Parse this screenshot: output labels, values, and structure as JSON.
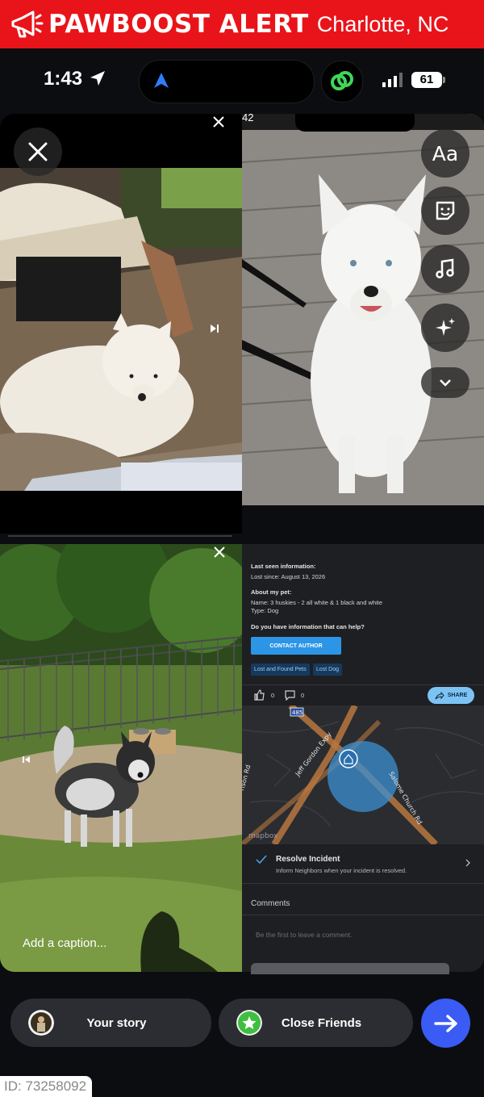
{
  "banner": {
    "brand": "PAWBOOST ALERT",
    "location": "Charlotte, NC",
    "icon": "megaphone-icon",
    "bg_color": "#e8141a"
  },
  "status_bar": {
    "time": "1:43",
    "battery": "61",
    "icons": [
      "location-arrow-icon",
      "signal-icon",
      "battery-icon"
    ]
  },
  "left_top_panel": {
    "close_icon": "close-icon",
    "secondary_close_icon": "close-icon",
    "play_icon": "skip-icon"
  },
  "right_top_panel": {
    "peek_time": "42",
    "tools": [
      {
        "name": "text-tool",
        "label": "Aa"
      },
      {
        "name": "sticker-tool",
        "icon": "sticker-icon"
      },
      {
        "name": "music-tool",
        "icon": "music-icon"
      },
      {
        "name": "effects-tool",
        "icon": "sparkles-icon"
      },
      {
        "name": "more-tool",
        "icon": "chevron-down-icon"
      }
    ]
  },
  "left_bottom_panel": {
    "caption_placeholder": "Add a caption...",
    "close_icon": "close-icon",
    "prev_icon": "skip-back-icon"
  },
  "screenshot": {
    "last_seen_heading": "Last seen information:",
    "lost_since": "Lost since: August 13, 2026",
    "about_heading": "About my pet:",
    "name_line": "Name: 3 huskies - 2 all white & 1 black and white",
    "type_line": "Type: Dog",
    "info_question": "Do you have information that can help?",
    "contact_button": "CONTACT AUTHOR",
    "tags": [
      "Lost and Found Pets",
      "Lost Dog"
    ],
    "likes": "0",
    "comments_count": "0",
    "share_label": "SHARE",
    "map": {
      "highway_shield": "485",
      "roads": [
        "Jeff Gordon Expy",
        "Salome Church Rd",
        "rison Rd"
      ],
      "attribution": "mapbox"
    },
    "resolve_title": "Resolve Incident",
    "resolve_sub": "Inform Neighbors when your incident is resolved.",
    "comments_heading": "Comments",
    "comment_placeholder": "Be the first to leave a comment."
  },
  "bottom_bar": {
    "your_story": "Your story",
    "close_friends": "Close Friends",
    "next_icon": "arrow-right-icon",
    "accent": "#3a5bf4",
    "friends_color": "#3fbe42"
  },
  "footer": {
    "id": "ID: 73258092"
  }
}
